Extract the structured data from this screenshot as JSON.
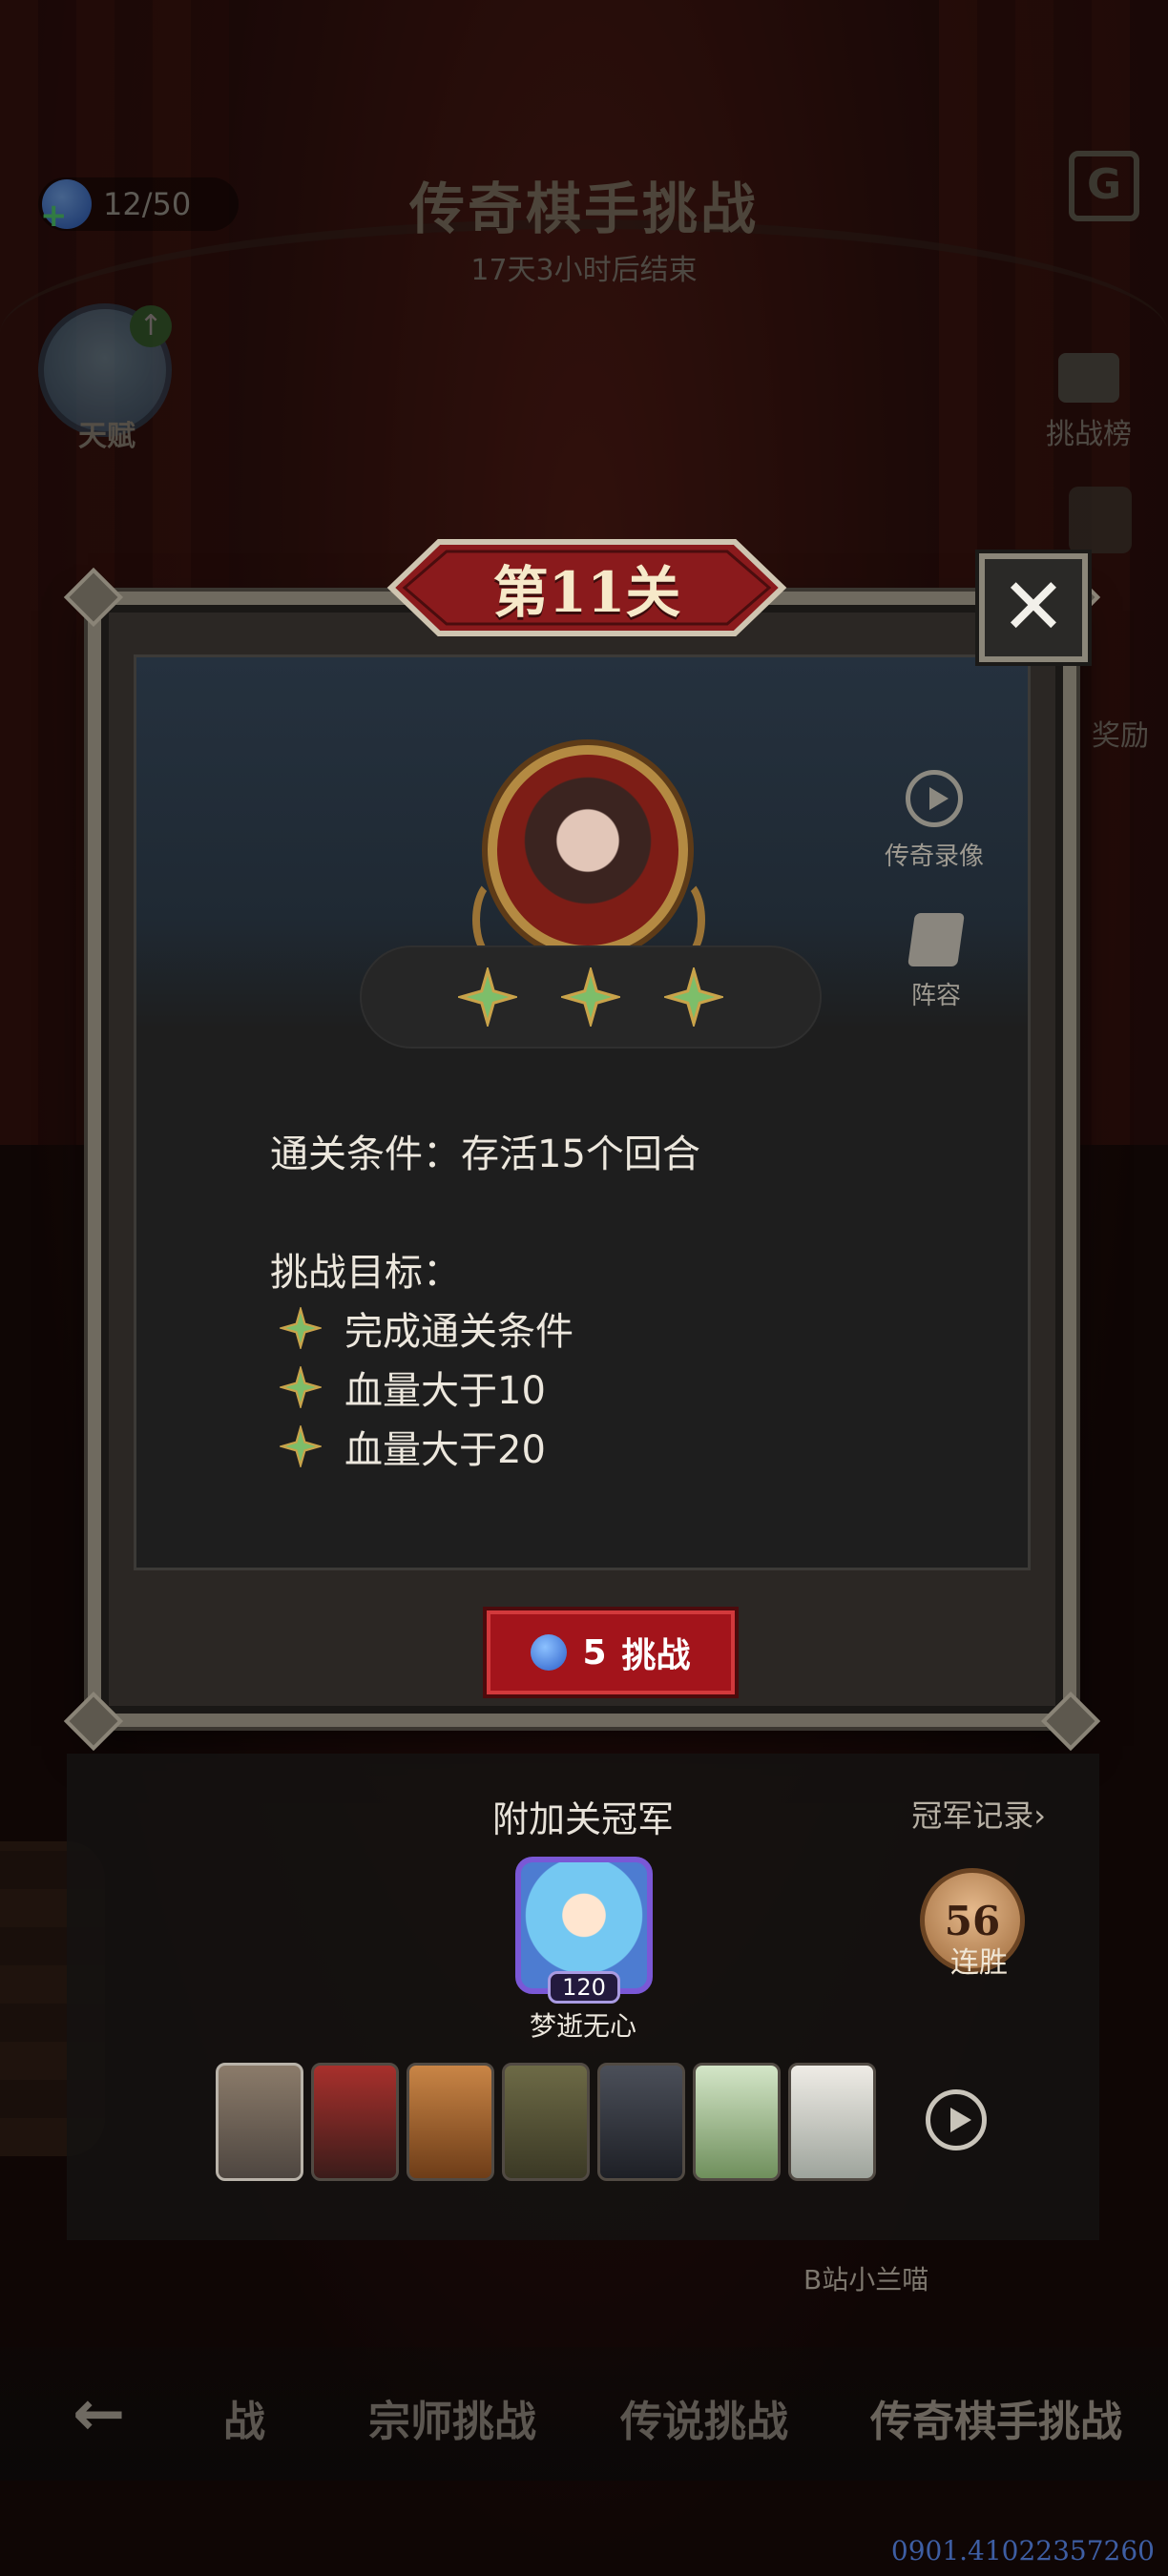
{
  "hud": {
    "energy": "12/50",
    "event_title": "传奇棋手挑战",
    "timer": "17天3小时后结束",
    "talent_label": "天赋",
    "ranking_label": "挑战榜",
    "reward_label": "奖励"
  },
  "modal": {
    "level_title": "第11关",
    "close_label": "✕",
    "stars_earned": 3,
    "replay_label": "传奇录像",
    "lineup_label": "阵容",
    "condition": "通关条件：存活15个回合",
    "goal_title": "挑战目标：",
    "goals": [
      "完成通关条件",
      "血量大于10",
      "血量大于20"
    ],
    "challenge_cost": "5",
    "challenge_label": "挑战"
  },
  "champion": {
    "title": "附加关冠军",
    "record_link": "冠军记录›",
    "avatar_level": "120",
    "name": "梦逝无心",
    "streak_value": "56",
    "streak_label": "连胜",
    "units": [
      "unit-1",
      "unit-2",
      "unit-3",
      "unit-4",
      "unit-5",
      "unit-6",
      "unit-7"
    ],
    "bg_username": "B站小兰喵"
  },
  "bottom_nav": {
    "back": "←",
    "tabs": [
      "战",
      "宗师挑战",
      "传说挑战",
      "传奇棋手挑战"
    ]
  },
  "watermark": "0901.41022357260",
  "colors": {
    "accent_red": "#a3141b",
    "star_green": "#7dbe6a",
    "frame_gray": "#6f6a5f"
  }
}
